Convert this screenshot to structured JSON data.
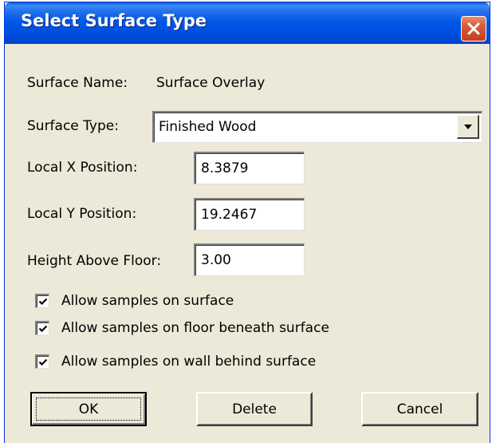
{
  "window": {
    "title": "Select Surface Type"
  },
  "surface_name": {
    "label": "Surface Name:",
    "value": "Surface Overlay"
  },
  "surface_type": {
    "label": "Surface Type:",
    "selected": "Finished Wood"
  },
  "local_x": {
    "label": "Local X Position:",
    "value": "8.3879"
  },
  "local_y": {
    "label": "Local Y Position:",
    "value": "19.2467"
  },
  "height": {
    "label": "Height Above Floor:",
    "value": "3.00"
  },
  "options": [
    {
      "label": "Allow samples on surface",
      "checked": true
    },
    {
      "label": "Allow samples on floor beneath surface",
      "checked": true
    },
    {
      "label": "Allow samples on wall behind surface",
      "checked": true
    }
  ],
  "buttons": {
    "ok": "OK",
    "delete": "Delete",
    "cancel": "Cancel"
  },
  "icons": {
    "close": "close-icon",
    "dropdown": "chevron-down-icon",
    "check": "checkmark-icon"
  },
  "colors": {
    "titlebar": "#0058e6",
    "dialog_bg": "#ece9d8",
    "close_button": "#d85a3a"
  }
}
